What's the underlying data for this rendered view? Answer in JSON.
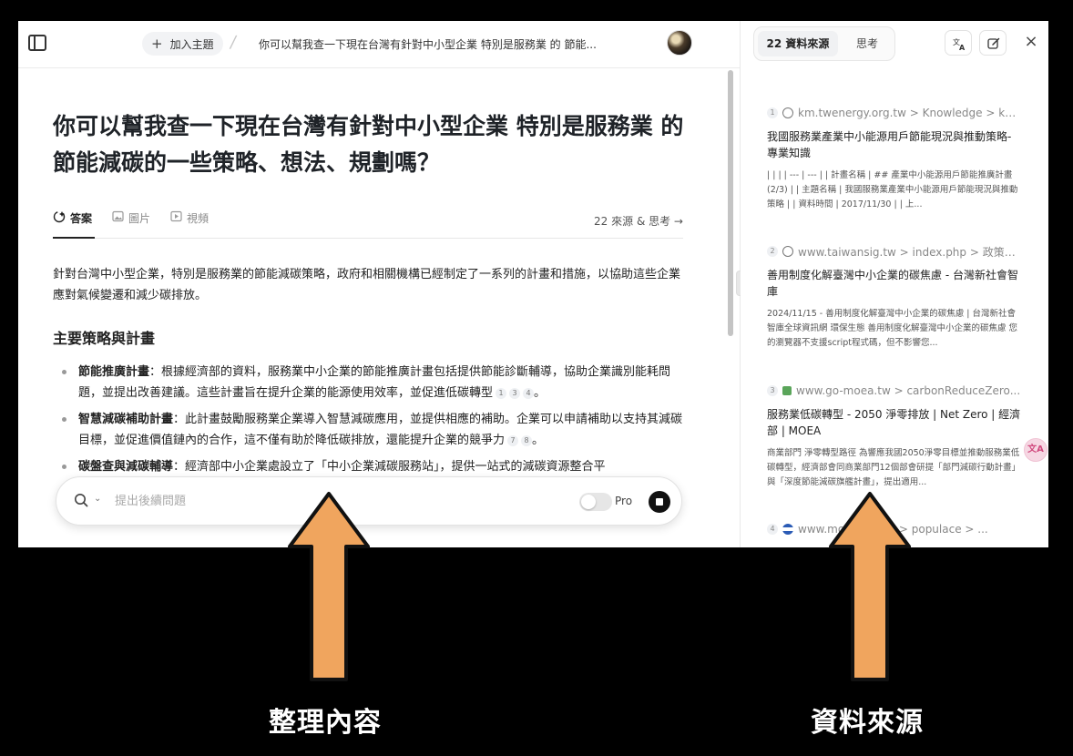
{
  "topbar": {
    "add_topic": "加入主題",
    "breadcrumb_title": "你可以幫我查一下現在台灣有針對中小型企業 特別是服務業 的 節能..."
  },
  "main": {
    "title": "你可以幫我查一下現在台灣有針對中小型企業 特別是服務業 的 節能減碳的一些策略、想法、規劃嗎？",
    "tabs": [
      {
        "label": "答案",
        "icon": "sparkle-answer-icon"
      },
      {
        "label": "圖片",
        "icon": "image-icon"
      },
      {
        "label": "視頻",
        "icon": "play-video-icon"
      }
    ],
    "sources_link": "22 來源 & 思考 →",
    "intro": "針對台灣中小型企業，特別是服務業的節能減碳策略，政府和相關機構已經制定了一系列的計畫和措施，以協助這些企業應對氣候變遷和減少碳排放。",
    "section_heading": "主要策略與計畫",
    "bullets": [
      {
        "bold": "節能推廣計畫",
        "text": "：根據經濟部的資料，服務業中小企業的節能推廣計畫包括提供節能診斷輔導，協助企業識別能耗問題，並提出改善建議。這些計畫旨在提升企業的能源使用效率，並促進低碳轉型",
        "cites": [
          "1",
          "3",
          "4"
        ],
        "end": "。"
      },
      {
        "bold": "智慧減碳補助計畫",
        "text": "：此計畫鼓勵服務業企業導入智慧減碳應用，並提供相應的補助。企業可以申請補助以支持其減碳目標，並促進價值鏈內的合作，這不僅有助於降低碳排放，還能提升企業的競爭力",
        "cites": [
          "7",
          "8"
        ],
        "end": "。"
      },
      {
        "bold": "碳盤查與減碳輔導",
        "text": "：經濟部中小企業處設立了「中小企業減碳服務站」，提供一站式的減碳資源整合平",
        "cites": [],
        "end": ""
      }
    ],
    "followup": {
      "placeholder": "提出後續問題",
      "pro_label": "Pro"
    }
  },
  "side": {
    "tab_sources": "22 資料來源",
    "tab_thinking": "思考",
    "sources": [
      {
        "num": "1",
        "favicon": "globe",
        "site": "km.twenergy.org.tw > Knowledge > kno...",
        "title": "我國服務業產業中小能源用戶節能現況與推動策略-專業知識",
        "snippet": "| | | | --- | --- | | 計畫名稱 | ## 產業中小能源用戶節能推廣計畫(2/3) | | 主題名稱 | 我國服務業產業中小能源用戶節能現況與推動策略 | | 資料時間 | 2017/11/30 | | 上..."
      },
      {
        "num": "2",
        "favicon": "globe",
        "site": "www.taiwansig.tw > index.php > 政策報...",
        "title": "善用制度化解臺灣中小企業的碳焦慮 - 台灣新社會智庫",
        "snippet": "2024/11/15 - 善用制度化解臺灣中小企業的碳焦慮 | 台灣新社會智庫全球資訊網 環保生態 善用制度化解臺灣中小企業的碳焦慮 您的瀏覽器不支援script程式碼，但不影響您..."
      },
      {
        "num": "3",
        "favicon": "green",
        "site": "www.go-moea.tw > carbonReduceZero...",
        "title": "服務業低碳轉型 - 2050 淨零排放 | Net Zero | 經濟部 | MOEA",
        "snippet": "商業部門 淨零轉型路徑 為響應我國2050淨零目標並推動服務業低碳轉型，經濟部會同商業部門12個部會研提「部門減碳行動計畫」與「深度節能減碳旗艦計畫」，提出適用..."
      },
      {
        "num": "4",
        "favicon": "flag",
        "site": "www.mo... > MNS > populace > ...",
        "title": "",
        "snippet": ""
      }
    ]
  },
  "float_badge": "文A",
  "captions": {
    "left": "整理內容",
    "right": "資料來源"
  },
  "colors": {
    "arrow_fill": "#f0a55e",
    "arrow_stroke": "#111111"
  }
}
